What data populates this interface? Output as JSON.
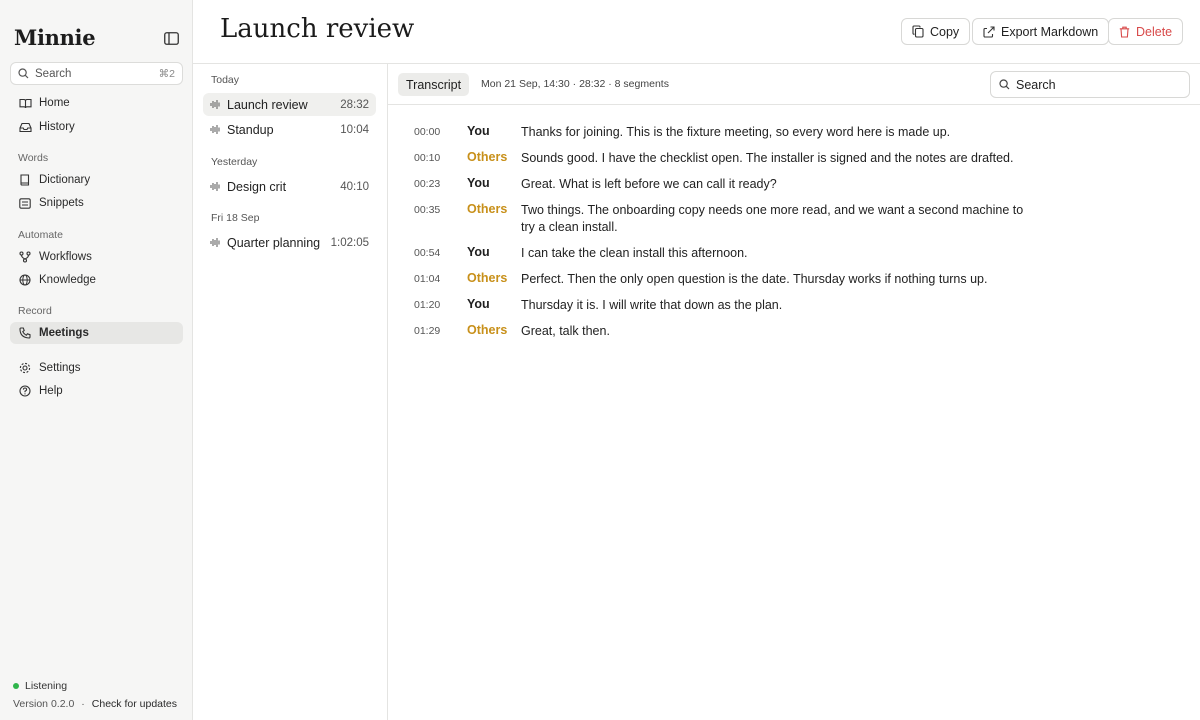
{
  "sidebar": {
    "logo": "Minnie",
    "search": {
      "label": "Search",
      "shortcut": "⌘2"
    },
    "main_items": [
      {
        "label": "Home",
        "icon": "book-icon"
      },
      {
        "label": "History",
        "icon": "inbox-icon"
      }
    ],
    "sections": {
      "words": "Words",
      "automate": "Automate",
      "record": "Record"
    },
    "words_items": [
      {
        "label": "Dictionary",
        "icon": "book-icon"
      },
      {
        "label": "Snippets",
        "icon": "list-icon"
      }
    ],
    "automate_items": [
      {
        "label": "Workflows",
        "icon": "workflow-icon"
      },
      {
        "label": "Knowledge",
        "icon": "globe-icon"
      }
    ],
    "record_items": [
      {
        "label": "Meetings",
        "icon": "phone-icon",
        "active": true
      }
    ],
    "bottom_items": [
      {
        "label": "Settings",
        "icon": "gear-icon"
      },
      {
        "label": "Help",
        "icon": "help-icon"
      }
    ],
    "status": "Listening",
    "status_color": "#2fb54b",
    "version": "Version 0.2.0",
    "separator": "·",
    "update_link": "Check for updates"
  },
  "header": {
    "title": "Launch review",
    "copy_label": "Copy",
    "export_label": "Export Markdown",
    "delete_label": "Delete"
  },
  "meetings": {
    "groups": [
      {
        "label": "Today",
        "items": [
          {
            "name": "Launch review",
            "duration": "28:32",
            "active": true
          },
          {
            "name": "Standup",
            "duration": "10:04"
          }
        ]
      },
      {
        "label": "Yesterday",
        "items": [
          {
            "name": "Design crit",
            "duration": "40:10"
          }
        ]
      },
      {
        "label": "Fri 18 Sep",
        "items": [
          {
            "name": "Quarter planning",
            "duration": "1:02:05"
          }
        ]
      }
    ]
  },
  "transcript": {
    "tab_label": "Transcript",
    "meta": "Mon 21 Sep, 14:30 · 28:32 · 8 segments",
    "search_placeholder": "Search",
    "speaker_colors": {
      "You": "#1f1f1f",
      "Others": "#c8901a"
    },
    "segments": [
      {
        "time": "00:00",
        "speaker": "You",
        "text": "Thanks for joining. This is the fixture meeting, so every word here is made up."
      },
      {
        "time": "00:10",
        "speaker": "Others",
        "text": "Sounds good. I have the checklist open. The installer is signed and the notes are drafted."
      },
      {
        "time": "00:23",
        "speaker": "You",
        "text": "Great. What is left before we can call it ready?"
      },
      {
        "time": "00:35",
        "speaker": "Others",
        "text": "Two things. The onboarding copy needs one more read, and we want a second machine to try a clean install."
      },
      {
        "time": "00:54",
        "speaker": "You",
        "text": "I can take the clean install this afternoon."
      },
      {
        "time": "01:04",
        "speaker": "Others",
        "text": "Perfect. Then the only open question is the date. Thursday works if nothing turns up."
      },
      {
        "time": "01:20",
        "speaker": "You",
        "text": "Thursday it is. I will write that down as the plan."
      },
      {
        "time": "01:29",
        "speaker": "Others",
        "text": "Great, talk then."
      }
    ]
  }
}
